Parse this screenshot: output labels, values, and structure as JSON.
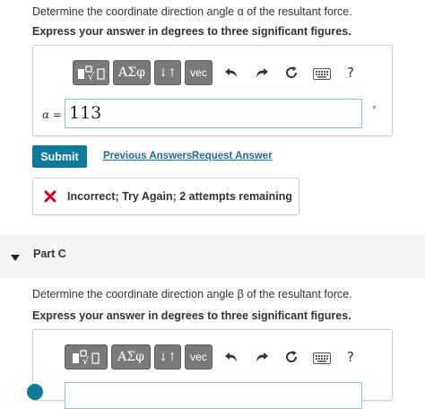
{
  "partB": {
    "question": "Determine the coordinate direction angle α of the resultant force.",
    "instruction": "Express your answer in degrees to three significant figures.",
    "toolbar": {
      "templates_label": "",
      "greek_label": "ΑΣφ",
      "arrows_label": "↓↑",
      "vec_label": "vec",
      "help_label": "?"
    },
    "answer_label": "α =",
    "answer_value": "113",
    "unit": "°",
    "submit_label": "Submit",
    "previous_answers_label": "Previous Answers",
    "request_answer_label": "Request Answer",
    "feedback_text": "Incorrect; Try Again; 2 attempts remaining",
    "feedback_color": "#d0021b"
  },
  "partC": {
    "header_label": "Part C",
    "question": "Determine the coordinate direction angle β of the resultant force.",
    "instruction": "Express your answer in degrees to three significant figures.",
    "toolbar": {
      "greek_label": "ΑΣφ",
      "arrows_label": "↓↑",
      "vec_label": "vec",
      "help_label": "?"
    }
  },
  "colors": {
    "accent": "#0f7a9a",
    "link": "#1a6ea0",
    "toolbar_button": "#7a7a7a",
    "part_header_bg": "#f5f5f5"
  }
}
